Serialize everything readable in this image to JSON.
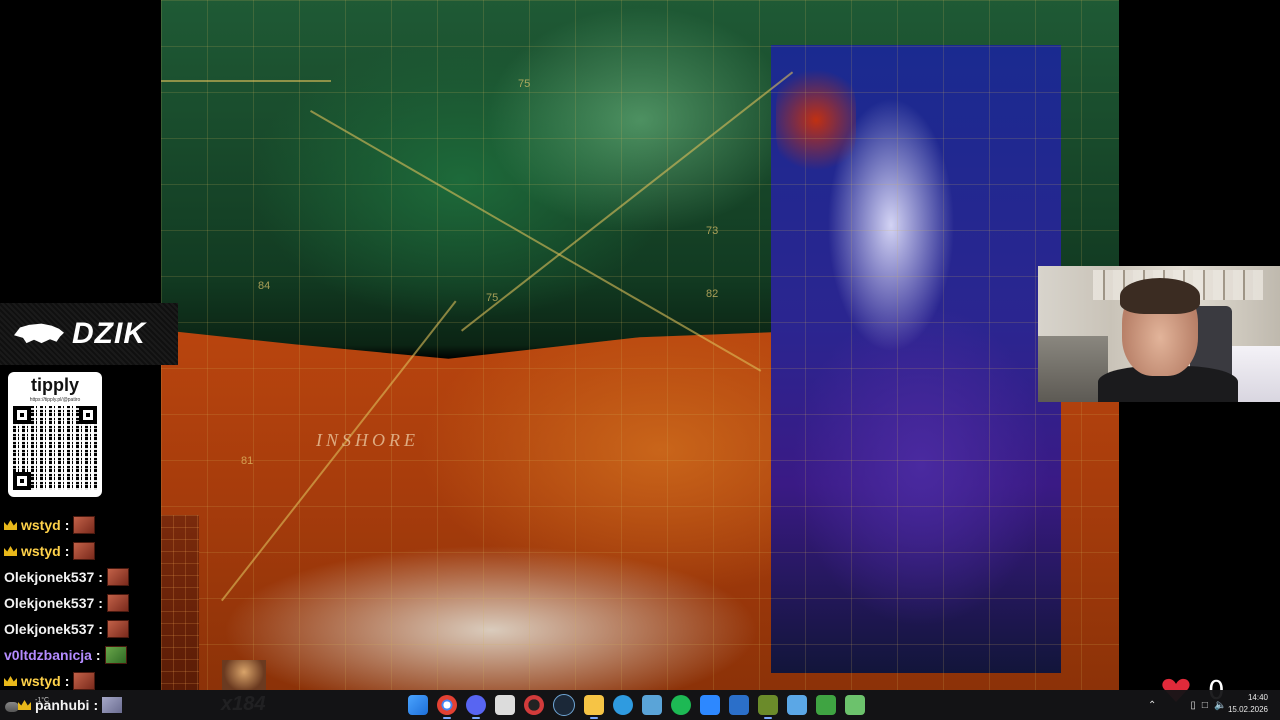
{
  "overlay": {
    "sponsor_logo": "DZIK",
    "tipply": {
      "brand": "tipply",
      "url": "https://tipply.pl/@patiro"
    },
    "video_label": "INSHORE",
    "depth_marks": [
      "75",
      "73",
      "75",
      "81",
      "84",
      "82"
    ],
    "sub_counter": "x184"
  },
  "chat": [
    {
      "user": "wstyd",
      "badge": "crown-icon",
      "color": "yellow",
      "emote": "emote-face"
    },
    {
      "user": "wstyd",
      "badge": "crown-icon",
      "color": "yellow",
      "emote": "emote-face"
    },
    {
      "user": "Olekjonek537",
      "badge": "",
      "color": "white",
      "emote": "emote-face"
    },
    {
      "user": "Olekjonek537",
      "badge": "",
      "color": "white",
      "emote": "emote-face"
    },
    {
      "user": "Olekjonek537",
      "badge": "",
      "color": "white",
      "emote": "emote-face"
    },
    {
      "user": "v0ltdzbanicja",
      "badge": "",
      "color": "purple",
      "emote": "emote-frog"
    },
    {
      "user": "wstyd",
      "badge": "crown-icon",
      "color": "yellow",
      "emote": "emote-face"
    },
    {
      "user": "panhubi",
      "badge": "crown-icon",
      "color": "white",
      "emote": "emote-grey"
    }
  ],
  "chat_separator": ":",
  "heart_widget": {
    "count": "0"
  },
  "taskbar": {
    "weather": "-1°C",
    "apps": [
      {
        "name": "windows-start",
        "color": "#3d8bf2"
      },
      {
        "name": "chrome",
        "color": "#e34133"
      },
      {
        "name": "discord",
        "color": "#5865f2"
      },
      {
        "name": "notes",
        "color": "#dddddd"
      },
      {
        "name": "recorder",
        "color": "#d23b3b"
      },
      {
        "name": "steam",
        "color": "#1b2838"
      },
      {
        "name": "file-explorer",
        "color": "#f6c445"
      },
      {
        "name": "ccleaner",
        "color": "#2f9be0"
      },
      {
        "name": "network-tool",
        "color": "#5aa4d8"
      },
      {
        "name": "spotify",
        "color": "#1db954"
      },
      {
        "name": "messenger",
        "color": "#2d88ff"
      },
      {
        "name": "xbox-tool",
        "color": "#2b6fc9"
      },
      {
        "name": "controller-app",
        "color": "#6b8b2a"
      },
      {
        "name": "notepad",
        "color": "#5ba7e6"
      },
      {
        "name": "utility-green",
        "color": "#3fa442"
      },
      {
        "name": "terminal-green",
        "color": "#6cc26c"
      }
    ],
    "time": "14:40",
    "date": "15.02.2026"
  }
}
